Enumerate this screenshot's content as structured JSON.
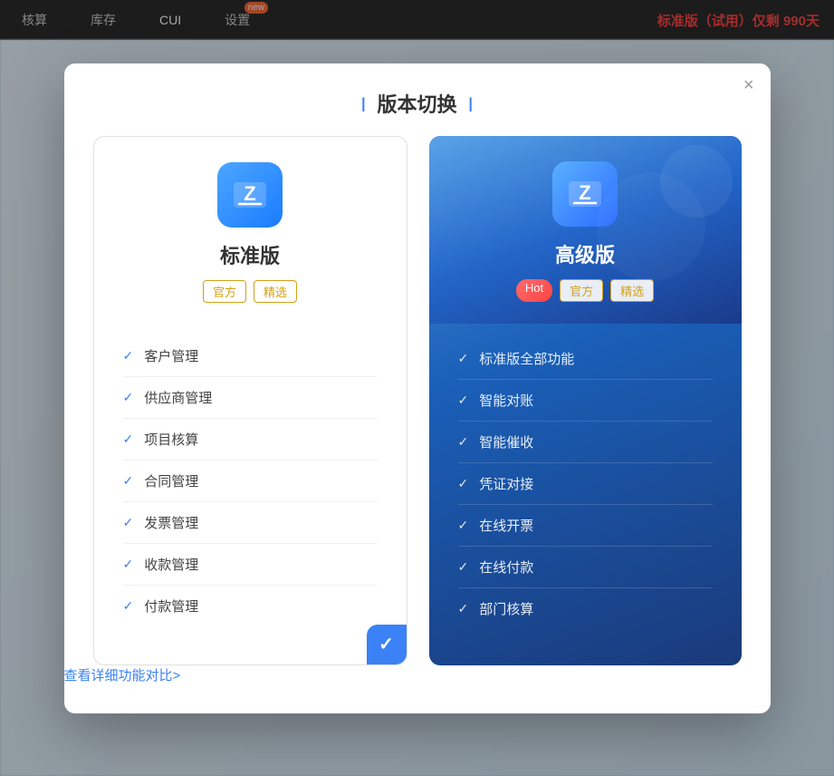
{
  "nav": {
    "items": [
      {
        "label": "核算",
        "active": false
      },
      {
        "label": "库存",
        "active": false
      },
      {
        "label": "CUI",
        "active": true
      },
      {
        "label": "设置",
        "active": false,
        "badge": "new"
      }
    ],
    "trial_text": "标准版（试用）仅剩 ",
    "trial_days": "990天",
    "trial_suffix": ""
  },
  "modal": {
    "title_bar_left": "I",
    "title_text": "版本切换",
    "title_bar_right": "I",
    "close_label": "×",
    "compare_link": "查看详细功能对比>"
  },
  "standard_card": {
    "name": "标准版",
    "tags": [
      "官方",
      "精选"
    ],
    "features": [
      "客户管理",
      "供应商管理",
      "项目核算",
      "合同管理",
      "发票管理",
      "收款管理",
      "付款管理"
    ],
    "selected": true
  },
  "premium_card": {
    "name": "高级版",
    "tags": [
      "Hot",
      "官方",
      "精选"
    ],
    "features": [
      "标准版全部功能",
      "智能对账",
      "智能催收",
      "凭证对接",
      "在线开票",
      "在线付款",
      "部门核算"
    ],
    "selected": false
  }
}
